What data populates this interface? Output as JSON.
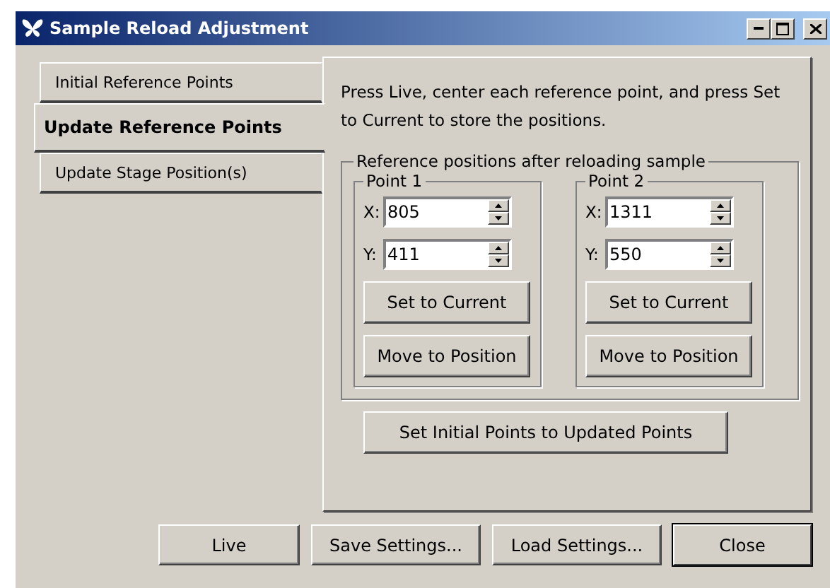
{
  "window": {
    "title": "Sample Reload Adjustment"
  },
  "tabs": [
    {
      "label": "Initial Reference Points",
      "selected": false
    },
    {
      "label": "Update Reference Points",
      "selected": true
    },
    {
      "label": "Update Stage Position(s)",
      "selected": false
    }
  ],
  "instructions": "Press Live, center each reference point, and press Set to Current to store the positions.",
  "group": {
    "title": "Reference positions after reloading sample",
    "points": [
      {
        "title": "Point 1",
        "fields": [
          {
            "label": "X:",
            "value": "805"
          },
          {
            "label": "Y:",
            "value": "411"
          }
        ],
        "buttons": [
          "Set to Current",
          "Move to Position"
        ]
      },
      {
        "title": "Point 2",
        "fields": [
          {
            "label": "X:",
            "value": "1311"
          },
          {
            "label": "Y:",
            "value": "550"
          }
        ],
        "buttons": [
          "Set to Current",
          "Move to Position"
        ]
      }
    ]
  },
  "update_button": "Set Initial Points to Updated Points",
  "buttons": [
    {
      "label": "Live",
      "default": false
    },
    {
      "label": "Save Settings...",
      "default": false
    },
    {
      "label": "Load Settings...",
      "default": false
    },
    {
      "label": "Close",
      "default": true
    }
  ]
}
